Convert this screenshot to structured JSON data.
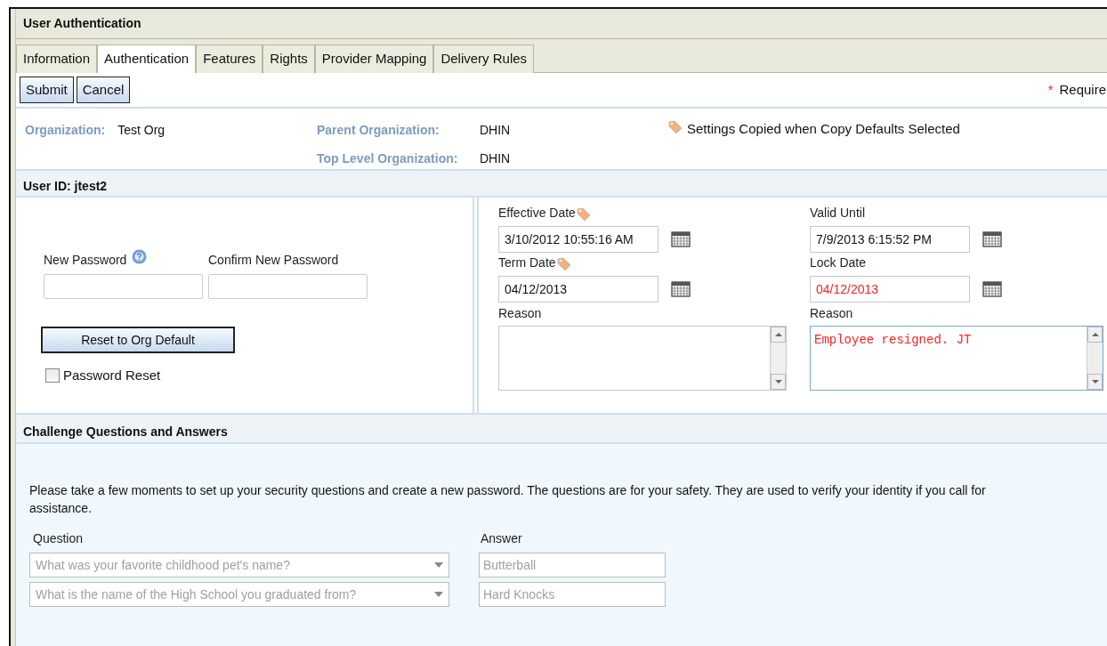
{
  "panel": {
    "title": "User Authentication"
  },
  "tabs": [
    {
      "label": "Information",
      "selected": false
    },
    {
      "label": "Authentication",
      "selected": true
    },
    {
      "label": "Features",
      "selected": false
    },
    {
      "label": "Rights",
      "selected": false
    },
    {
      "label": "Provider Mapping",
      "selected": false
    },
    {
      "label": "Delivery Rules",
      "selected": false
    }
  ],
  "toolbar": {
    "buttons": [
      "Submit",
      "Cancel"
    ],
    "required_mark": "*",
    "required_label": "Require"
  },
  "organization": {
    "org_label": "Organization:",
    "org_value": "Test Org",
    "parent_label": "Parent Organization:",
    "parent_value": "DHIN",
    "top_label": "Top Level Organization:",
    "top_value": "DHIN",
    "note": "Settings Copied when Copy Defaults Selected"
  },
  "user_section": {
    "title": "User ID: jtest2",
    "new_password": {
      "label": "New Password"
    },
    "confirm_password": {
      "label": "Confirm New Password"
    },
    "reset_button": "Reset to Org Default",
    "password_reset": {
      "label": "Password Reset",
      "checked": false
    },
    "dates": [
      {
        "label": "Effective Date",
        "value": "3/10/2012 10:55:16 AM",
        "tagged": true,
        "warning": false
      },
      {
        "label": "Valid Until",
        "value": "7/9/2013 6:15:52 PM",
        "tagged": false,
        "warning": false
      },
      {
        "label": "Term Date",
        "value": "04/12/2013",
        "tagged": true,
        "warning": false
      },
      {
        "label": "Lock Date",
        "value": "04/12/2013",
        "tagged": false,
        "warning": true
      }
    ],
    "reasons": [
      {
        "label": "Reason",
        "warning": false
      },
      {
        "label": "Reason",
        "value": "Employee resigned. JT",
        "warning": true
      }
    ]
  },
  "challenge": {
    "title": "Challenge Questions and Answers",
    "intro": "Please take a few moments to set up your security questions and create a new password. The questions are for your safety. They are used to verify your identity if you call for assistance.",
    "question_header": "Question",
    "answer_header": "Answer",
    "rows": [
      {
        "question": "What was your favorite childhood pet's name?",
        "answer": "Butterball",
        "disabled": true
      },
      {
        "question": "What is the name of the High School you graduated from?",
        "answer": "Hard Knocks",
        "disabled": true
      }
    ]
  }
}
